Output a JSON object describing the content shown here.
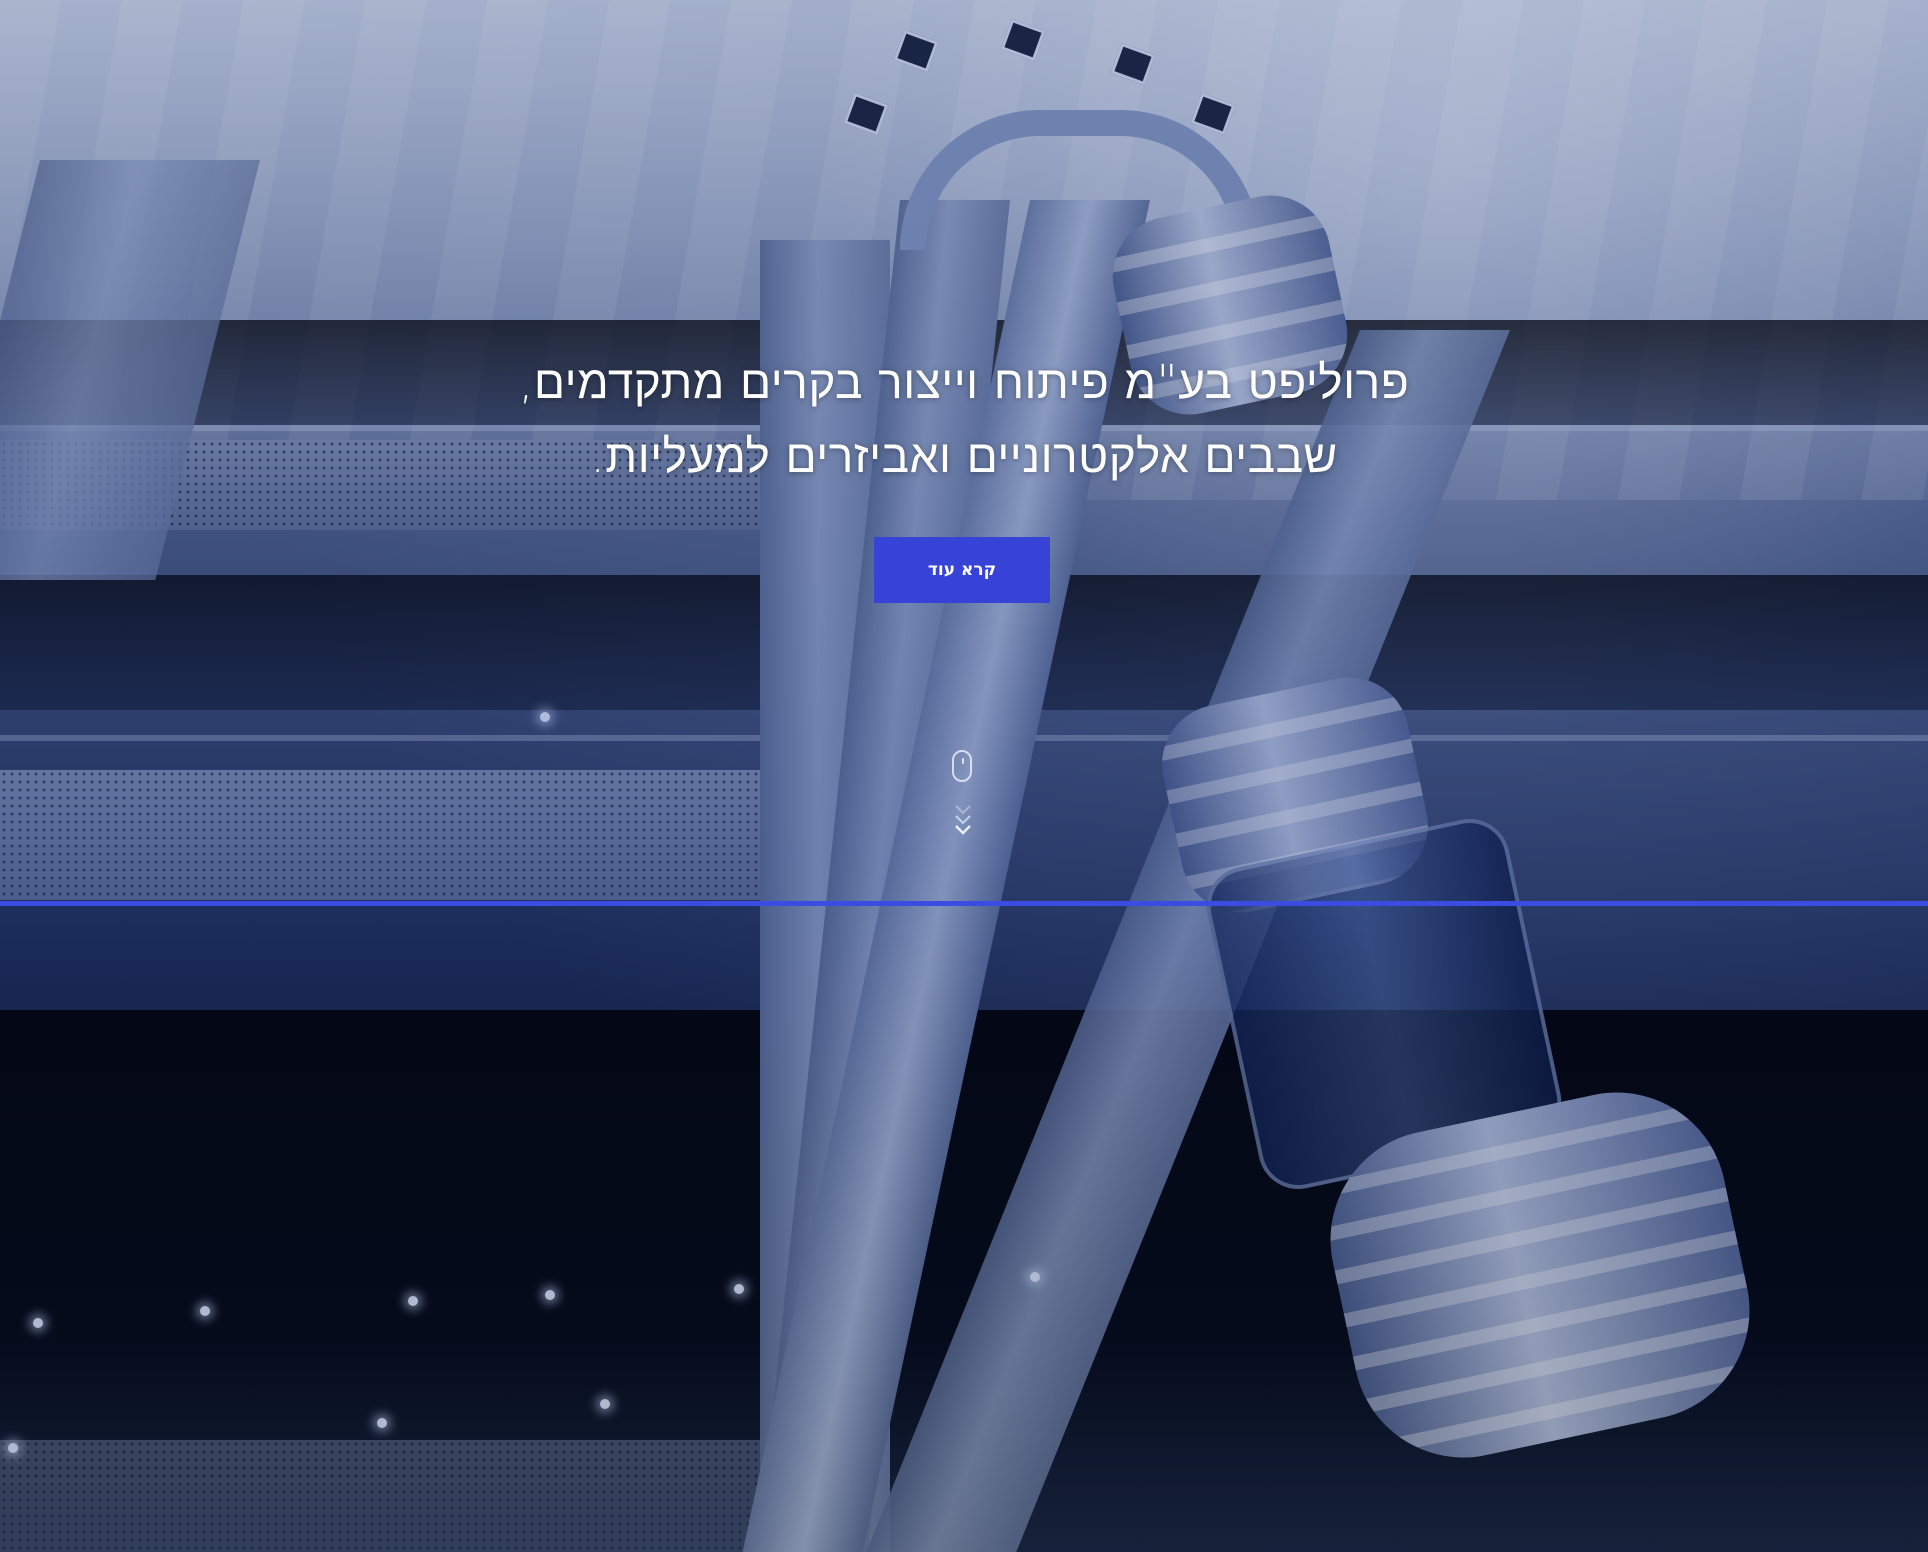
{
  "hero": {
    "headline_line1": "פרוליפט בע\"מ פיתוח וייצור בקרים מתקדמים,",
    "headline_line2": "שבבים אלקטרוניים ואביזרים למעליות.",
    "cta_label": "קרא עוד"
  },
  "icons": {
    "scroll_mouse": "mouse-icon",
    "scroll_arrows": "chevron-double-down-icon"
  },
  "colors": {
    "accent": "#3643d6",
    "divider_line": "#3b4de0",
    "text": "#ffffff"
  }
}
